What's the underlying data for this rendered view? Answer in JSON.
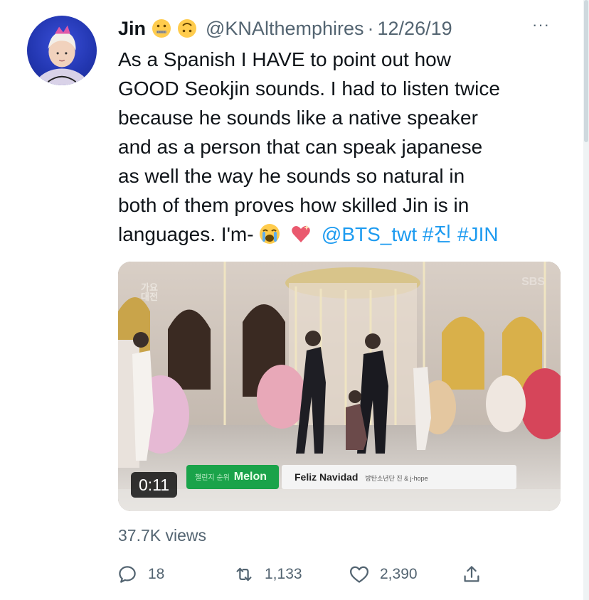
{
  "tweet": {
    "author": {
      "display_name": "Jin",
      "handle": "@KNAlthemphires",
      "separator": "·",
      "date": "12/26/19",
      "name_emojis": [
        "zipper-mouth-face-emoji",
        "upside-down-face-emoji"
      ],
      "avatar": "jin-avatar"
    },
    "more_label": "···",
    "text_lines": [
      "As a Spanish I HAVE to point out how",
      "GOOD Seokjin sounds. I had to listen twice",
      "because he sounds like a native speaker",
      "and as a person that can speak japanese",
      "as well the way he sounds so natural in",
      "both of them proves how skilled Jin is in"
    ],
    "last_line": {
      "text": "languages. I'm-",
      "emojis": [
        "loudly-crying-face-emoji",
        "sparkling-heart-emoji"
      ],
      "mention": "@BTS_twt",
      "hashtags": [
        "#진",
        "#JIN"
      ]
    },
    "media": {
      "type": "video",
      "duration": "0:11",
      "caption_melon": "Melon",
      "caption_melon_kr": "챌린지 순위",
      "caption_song": "Feliz Navidad",
      "caption_artist": "방탄소년단 진 & j-hope",
      "broadcaster": "SBS",
      "show_logo_line1": "가요",
      "show_logo_line2": "대전"
    },
    "views": "37.7K views",
    "actions": {
      "replies": "18",
      "retweets": "1,133",
      "likes": "2,390"
    },
    "colors": {
      "link": "#1d9bf0",
      "secondary_text": "#536471",
      "primary_text": "#0f1419"
    }
  }
}
